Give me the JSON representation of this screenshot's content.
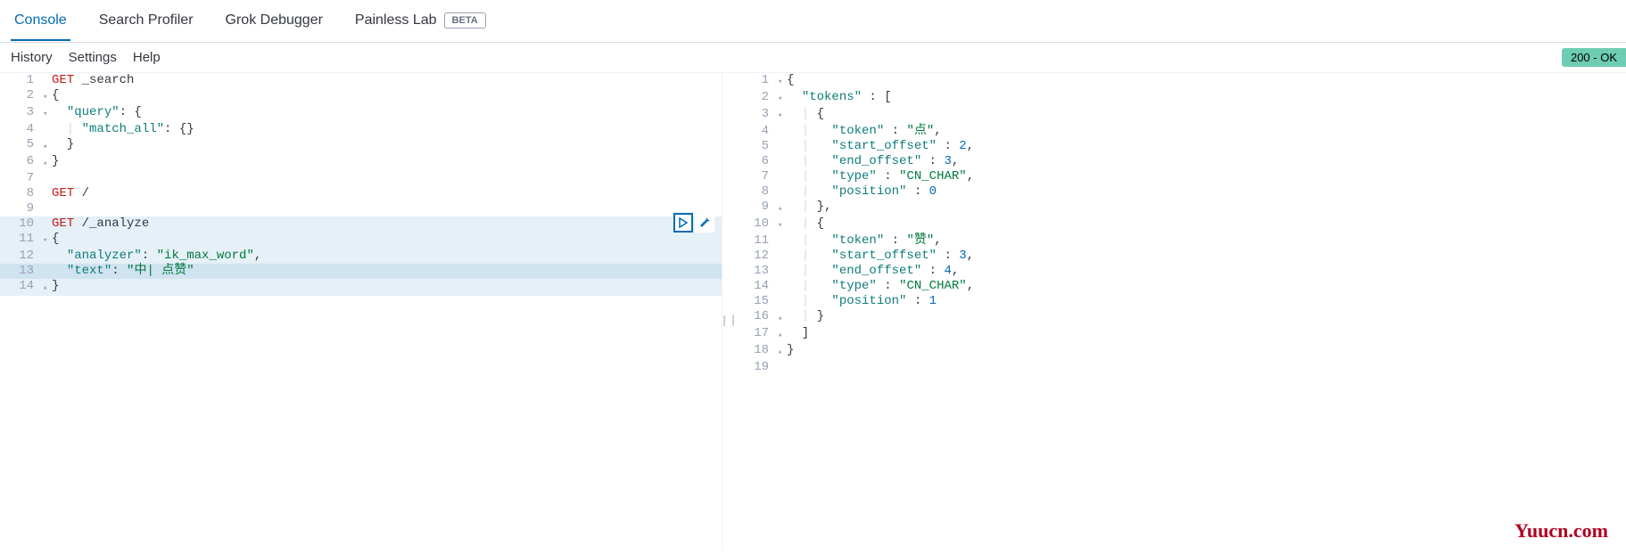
{
  "tabs": {
    "console": "Console",
    "search_profiler": "Search Profiler",
    "grok_debugger": "Grok Debugger",
    "painless_lab": "Painless Lab",
    "beta": "BETA"
  },
  "subbar": {
    "history": "History",
    "settings": "Settings",
    "help": "Help"
  },
  "status": "200 - OK",
  "request": {
    "lines": [
      {
        "n": "1",
        "fold": "",
        "hl": false,
        "cur": false,
        "segments": [
          [
            "kw",
            "GET "
          ],
          [
            "punct",
            "_search"
          ]
        ]
      },
      {
        "n": "2",
        "fold": "▾",
        "hl": false,
        "cur": false,
        "segments": [
          [
            "punct",
            "{"
          ]
        ]
      },
      {
        "n": "3",
        "fold": "▾",
        "hl": false,
        "cur": false,
        "segments": [
          [
            "punct",
            "  "
          ],
          [
            "key",
            "\"query\""
          ],
          [
            "punct",
            ": {"
          ]
        ]
      },
      {
        "n": "4",
        "fold": "",
        "hl": false,
        "cur": false,
        "segments": [
          [
            "guide",
            "  | "
          ],
          [
            "key",
            "\"match_all\""
          ],
          [
            "punct",
            ": {}"
          ]
        ]
      },
      {
        "n": "5",
        "fold": "▴",
        "hl": false,
        "cur": false,
        "segments": [
          [
            "punct",
            "  }"
          ]
        ]
      },
      {
        "n": "6",
        "fold": "▴",
        "hl": false,
        "cur": false,
        "segments": [
          [
            "punct",
            "}"
          ]
        ]
      },
      {
        "n": "7",
        "fold": "",
        "hl": false,
        "cur": false,
        "segments": [
          [
            "punct",
            ""
          ]
        ]
      },
      {
        "n": "8",
        "fold": "",
        "hl": false,
        "cur": false,
        "segments": [
          [
            "kw",
            "GET "
          ],
          [
            "punct",
            "/"
          ]
        ]
      },
      {
        "n": "9",
        "fold": "",
        "hl": false,
        "cur": false,
        "segments": [
          [
            "punct",
            ""
          ]
        ]
      },
      {
        "n": "10",
        "fold": "",
        "hl": true,
        "cur": false,
        "segments": [
          [
            "kw",
            "GET "
          ],
          [
            "punct",
            "/_analyze"
          ]
        ]
      },
      {
        "n": "11",
        "fold": "▾",
        "hl": true,
        "cur": false,
        "segments": [
          [
            "punct",
            "{"
          ]
        ]
      },
      {
        "n": "12",
        "fold": "",
        "hl": true,
        "cur": false,
        "segments": [
          [
            "punct",
            "  "
          ],
          [
            "key",
            "\"analyzer\""
          ],
          [
            "punct",
            ": "
          ],
          [
            "str",
            "\"ik_max_word\""
          ],
          [
            "punct",
            ","
          ]
        ]
      },
      {
        "n": "13",
        "fold": "",
        "hl": true,
        "cur": true,
        "segments": [
          [
            "punct",
            "  "
          ],
          [
            "key",
            "\"text\""
          ],
          [
            "punct",
            ": "
          ],
          [
            "str",
            "\"中| 点赞\""
          ]
        ]
      },
      {
        "n": "14",
        "fold": "▴",
        "hl": true,
        "cur": false,
        "segments": [
          [
            "punct",
            "}"
          ]
        ]
      }
    ]
  },
  "response": {
    "lines": [
      {
        "n": "1",
        "fold": "▾",
        "segments": [
          [
            "punct",
            "{"
          ]
        ]
      },
      {
        "n": "2",
        "fold": "▾",
        "segments": [
          [
            "punct",
            "  "
          ],
          [
            "key",
            "\"tokens\""
          ],
          [
            "punct",
            " : ["
          ]
        ]
      },
      {
        "n": "3",
        "fold": "▾",
        "segments": [
          [
            "guide",
            "  | "
          ],
          [
            "punct",
            "{"
          ]
        ]
      },
      {
        "n": "4",
        "fold": "",
        "segments": [
          [
            "guide",
            "  |   "
          ],
          [
            "key",
            "\"token\""
          ],
          [
            "punct",
            " : "
          ],
          [
            "str",
            "\"点\""
          ],
          [
            "punct",
            ","
          ]
        ]
      },
      {
        "n": "5",
        "fold": "",
        "segments": [
          [
            "guide",
            "  |   "
          ],
          [
            "key",
            "\"start_offset\""
          ],
          [
            "punct",
            " : "
          ],
          [
            "num",
            "2"
          ],
          [
            "punct",
            ","
          ]
        ]
      },
      {
        "n": "6",
        "fold": "",
        "segments": [
          [
            "guide",
            "  |   "
          ],
          [
            "key",
            "\"end_offset\""
          ],
          [
            "punct",
            " : "
          ],
          [
            "num",
            "3"
          ],
          [
            "punct",
            ","
          ]
        ]
      },
      {
        "n": "7",
        "fold": "",
        "segments": [
          [
            "guide",
            "  |   "
          ],
          [
            "key",
            "\"type\""
          ],
          [
            "punct",
            " : "
          ],
          [
            "str",
            "\"CN_CHAR\""
          ],
          [
            "punct",
            ","
          ]
        ]
      },
      {
        "n": "8",
        "fold": "",
        "segments": [
          [
            "guide",
            "  |   "
          ],
          [
            "key",
            "\"position\""
          ],
          [
            "punct",
            " : "
          ],
          [
            "num",
            "0"
          ]
        ]
      },
      {
        "n": "9",
        "fold": "▴",
        "segments": [
          [
            "guide",
            "  | "
          ],
          [
            "punct",
            "},"
          ]
        ]
      },
      {
        "n": "10",
        "fold": "▾",
        "segments": [
          [
            "guide",
            "  | "
          ],
          [
            "punct",
            "{"
          ]
        ]
      },
      {
        "n": "11",
        "fold": "",
        "segments": [
          [
            "guide",
            "  |   "
          ],
          [
            "key",
            "\"token\""
          ],
          [
            "punct",
            " : "
          ],
          [
            "str",
            "\"赞\""
          ],
          [
            "punct",
            ","
          ]
        ]
      },
      {
        "n": "12",
        "fold": "",
        "segments": [
          [
            "guide",
            "  |   "
          ],
          [
            "key",
            "\"start_offset\""
          ],
          [
            "punct",
            " : "
          ],
          [
            "num",
            "3"
          ],
          [
            "punct",
            ","
          ]
        ]
      },
      {
        "n": "13",
        "fold": "",
        "segments": [
          [
            "guide",
            "  |   "
          ],
          [
            "key",
            "\"end_offset\""
          ],
          [
            "punct",
            " : "
          ],
          [
            "num",
            "4"
          ],
          [
            "punct",
            ","
          ]
        ]
      },
      {
        "n": "14",
        "fold": "",
        "segments": [
          [
            "guide",
            "  |   "
          ],
          [
            "key",
            "\"type\""
          ],
          [
            "punct",
            " : "
          ],
          [
            "str",
            "\"CN_CHAR\""
          ],
          [
            "punct",
            ","
          ]
        ]
      },
      {
        "n": "15",
        "fold": "",
        "segments": [
          [
            "guide",
            "  |   "
          ],
          [
            "key",
            "\"position\""
          ],
          [
            "punct",
            " : "
          ],
          [
            "num",
            "1"
          ]
        ]
      },
      {
        "n": "16",
        "fold": "▴",
        "segments": [
          [
            "guide",
            "  | "
          ],
          [
            "punct",
            "}"
          ]
        ]
      },
      {
        "n": "17",
        "fold": "▴",
        "segments": [
          [
            "punct",
            "  ]"
          ]
        ]
      },
      {
        "n": "18",
        "fold": "▴",
        "segments": [
          [
            "punct",
            "}"
          ]
        ]
      },
      {
        "n": "19",
        "fold": "",
        "segments": [
          [
            "punct",
            ""
          ]
        ]
      }
    ]
  },
  "watermark": "Yuucn.com"
}
